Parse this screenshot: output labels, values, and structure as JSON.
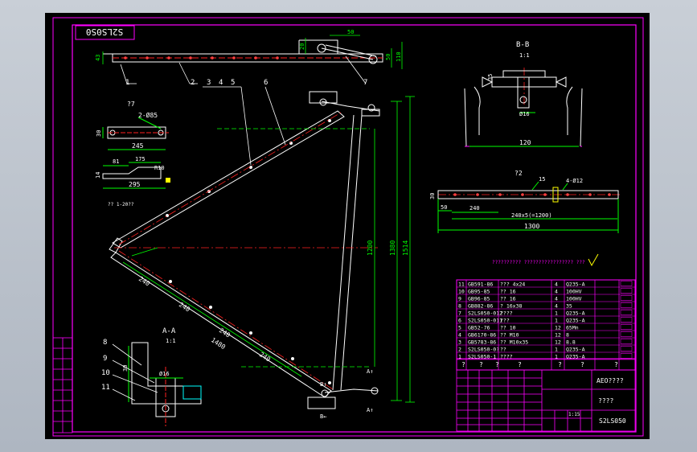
{
  "drawing": {
    "title_box": "S2LS0S0",
    "section_bb": "B-B",
    "section_bb_scale": "1:1",
    "section_aa": "A-A",
    "section_aa_scale": "1:1",
    "detail_12": "?2",
    "detail_7": "?7",
    "note_gt": "?? 1-20??",
    "chinese_note": "?????????? ????????????????? ???",
    "balloon_labels": [
      "1",
      "2",
      "3",
      "4",
      "5",
      "6",
      "7",
      "8",
      "9",
      "10",
      "11"
    ],
    "dimensions": {
      "d_20": "20",
      "d_43": "43",
      "d_50": "50",
      "d_110": "110",
      "d_1200": "1200",
      "d_1380": "1380",
      "d_1514": "1514",
      "d_240_a": "240",
      "d_240_b": "240",
      "d_240_c": "240",
      "d_240_d": "240",
      "d_1480": "1480",
      "d_2phi85": "2-Ø85",
      "d_30": "30",
      "d_245": "245",
      "d_81": "81",
      "d_175": "175",
      "d_r10": "R10",
      "d_14": "14",
      "d_295": "295",
      "d_35": "35",
      "d_phi16": "Ø16",
      "d_120": "120",
      "d_4phi12": "4-Ø12",
      "d_15": "15",
      "d_50b": "50",
      "d_240": "240",
      "d_240x5": "240x5(=1200)",
      "d_1300": "1300",
      "d_phi16_aa": "Ø16",
      "d_30_aa": "30",
      "d_a1": "A↑",
      "d_a2": "A↑",
      "d_b1": "B↑",
      "d_b2": "B←"
    }
  },
  "parts_table": {
    "rows": [
      {
        "no": "11",
        "code": "GB591-86",
        "name": "??? 4x24",
        "qty": "4",
        "material": "Q235-A"
      },
      {
        "no": "10",
        "code": "GB95-85",
        "name": "?? 16",
        "qty": "4",
        "material": "100HV"
      },
      {
        "no": "9",
        "code": "GB96-85",
        "name": "?? 16",
        "qty": "4",
        "material": "100HV"
      },
      {
        "no": "8",
        "code": "GB882-86",
        "name": "? 16x38",
        "qty": "4",
        "material": "35"
      },
      {
        "no": "7",
        "code": "S2LS050-012",
        "name": "????",
        "qty": "1",
        "material": "Q235-A"
      },
      {
        "no": "6",
        "code": "S2LS050-011",
        "name": "???",
        "qty": "1",
        "material": "Q235-A"
      },
      {
        "no": "5",
        "code": "GB52-76",
        "name": "?? 10",
        "qty": "12",
        "material": "65Mn"
      },
      {
        "no": "4",
        "code": "GB6170-86",
        "name": "?? M10",
        "qty": "12",
        "material": "8"
      },
      {
        "no": "3",
        "code": "GB5783-86",
        "name": "?? M10x35",
        "qty": "12",
        "material": "8.8"
      },
      {
        "no": "2",
        "code": "S2LS050-0?",
        "name": "??",
        "qty": "1",
        "material": "Q235-A"
      },
      {
        "no": "1",
        "code": "S2LS050-1",
        "name": "????",
        "qty": "1",
        "material": "Q235-A"
      }
    ],
    "question_row": [
      "?",
      "?",
      "?",
      "?",
      "?",
      "?",
      "?"
    ]
  },
  "title_block": {
    "company": "AEO????",
    "drawing_name": "????",
    "drawing_number": "S2LS050",
    "scale": "1:15"
  },
  "colors": {
    "frame": "#ff00ff",
    "lines": "#ffffff",
    "dimensions": "#00ff00",
    "centerline": "#ff2020",
    "labels": "#ffff00",
    "hidden": "#00ffff",
    "background": "#000000"
  }
}
